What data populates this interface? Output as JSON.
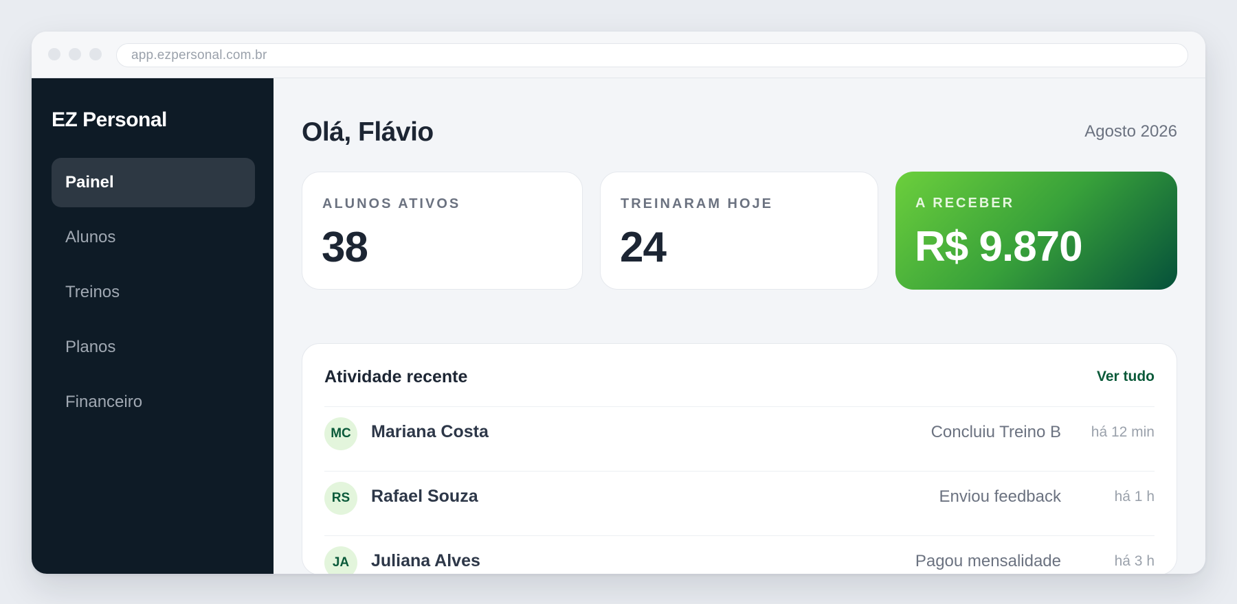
{
  "browser": {
    "url": "app.ezpersonal.com.br"
  },
  "sidebar": {
    "brand": "EZ Personal",
    "items": [
      {
        "label": "Painel",
        "active": true
      },
      {
        "label": "Alunos",
        "active": false
      },
      {
        "label": "Treinos",
        "active": false
      },
      {
        "label": "Planos",
        "active": false
      },
      {
        "label": "Financeiro",
        "active": false
      }
    ]
  },
  "header": {
    "greeting": "Olá, Flávio",
    "date": "Agosto 2026"
  },
  "stats": [
    {
      "label": "ALUNOS ATIVOS",
      "value": "38"
    },
    {
      "label": "TREINARAM HOJE",
      "value": "24"
    },
    {
      "label": "A RECEBER",
      "value": "R$ 9.870"
    }
  ],
  "activity": {
    "title": "Atividade recente",
    "link": "Ver tudo",
    "rows": [
      {
        "initials": "MC",
        "name": "Mariana Costa",
        "action": "Concluiu Treino B",
        "time": "há 12 min"
      },
      {
        "initials": "RS",
        "name": "Rafael Souza",
        "action": "Enviou feedback",
        "time": "há 1 h"
      },
      {
        "initials": "JA",
        "name": "Juliana Alves",
        "action": "Pagou mensalidade",
        "time": "há 3 h"
      }
    ]
  },
  "colors": {
    "sidebar_bg": "#0e1b26",
    "accent_green": "#0b5a3a",
    "gradient_start": "#6ccf3c",
    "gradient_end": "#05503a"
  }
}
